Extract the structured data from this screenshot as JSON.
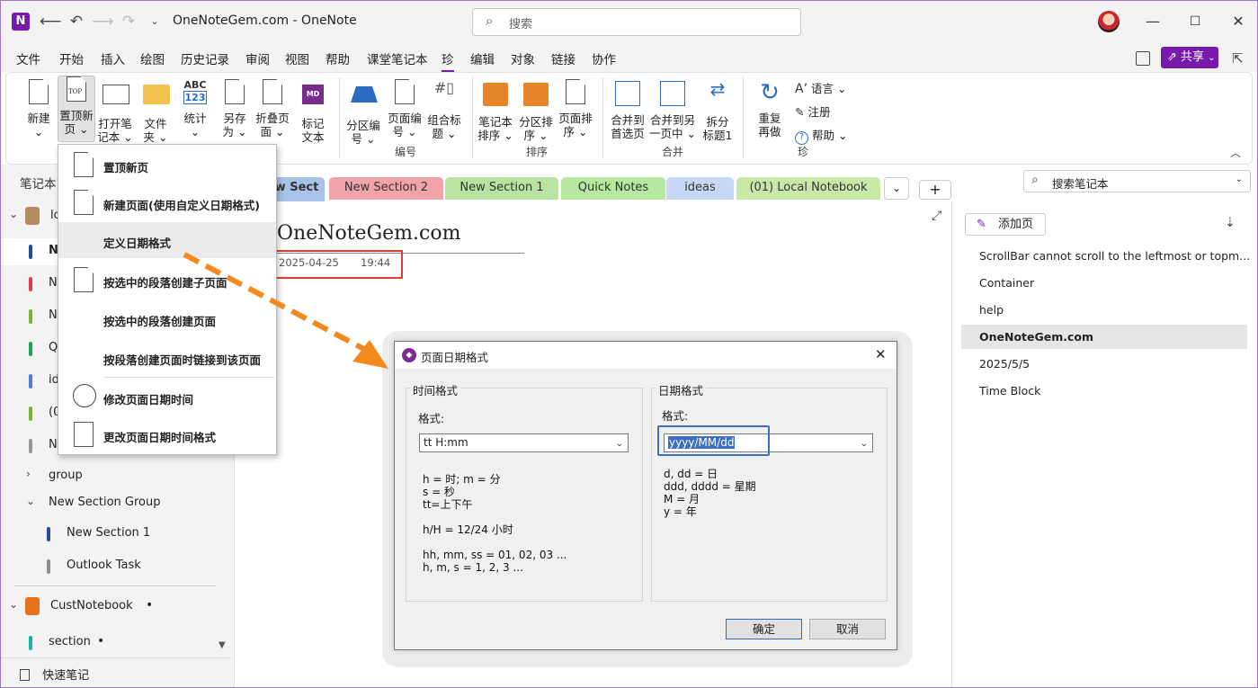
{
  "window": {
    "title": "OneNoteGem.com  -  OneNote",
    "search_placeholder": "搜索",
    "logo_letter": "N"
  },
  "menu": [
    "文件",
    "开始",
    "插入",
    "绘图",
    "历史记录",
    "审阅",
    "视图",
    "帮助",
    "课堂笔记本",
    "珍",
    "编辑",
    "对象",
    "链接",
    "协作"
  ],
  "menu_active_index": 9,
  "share_label": "共享",
  "ribbon": {
    "buttons": [
      {
        "id": "new",
        "l1": "新建",
        "l2": "⌄"
      },
      {
        "id": "top_new_page",
        "l1": "置顶新",
        "l2": "页 ⌄"
      },
      {
        "id": "open_notebook",
        "l1": "打开笔",
        "l2": "记本 ⌄"
      },
      {
        "id": "folder",
        "l1": "文件",
        "l2": "夹 ⌄"
      },
      {
        "id": "stats",
        "l1": "统计",
        "l2": "⌄"
      },
      {
        "id": "save_as",
        "l1": "另存",
        "l2": "为 ⌄"
      },
      {
        "id": "fold_page",
        "l1": "折叠页",
        "l2": "面 ⌄"
      },
      {
        "id": "markdown",
        "l1": "标记",
        "l2": "文本"
      },
      {
        "id": "section_no",
        "l1": "分区编",
        "l2": "号 ⌄"
      },
      {
        "id": "page_no",
        "l1": "页面编",
        "l2": "号 ⌄"
      },
      {
        "id": "heading_no",
        "l1": "组合标",
        "l2": "题 ⌄"
      },
      {
        "id": "nb_sort",
        "l1": "笔记本",
        "l2": "排序 ⌄"
      },
      {
        "id": "sec_sort",
        "l1": "分区排",
        "l2": "序 ⌄"
      },
      {
        "id": "page_sort",
        "l1": "页面排",
        "l2": "序 ⌄"
      },
      {
        "id": "merge_first",
        "l1": "合并到",
        "l2": "首选页"
      },
      {
        "id": "merge_other",
        "l1": "合并到另",
        "l2": "一页中 ⌄"
      },
      {
        "id": "split",
        "l1": "拆分",
        "l2": "标题1"
      },
      {
        "id": "redo",
        "l1": "重复",
        "l2": "再做"
      }
    ],
    "small_buttons": [
      {
        "label": "语言 ⌄"
      },
      {
        "label": "注册"
      },
      {
        "label": "帮助  ⌄"
      }
    ],
    "icon_texts": {
      "top": "TOP",
      "abc": "ABC",
      "num": "123",
      "md": "MD",
      "hash": "#"
    },
    "groups": [
      {
        "label": "编号"
      },
      {
        "label": "排序"
      },
      {
        "label": "合并"
      },
      {
        "label": "珍"
      }
    ]
  },
  "dropdown": [
    {
      "label": "置顶新页"
    },
    {
      "label": "新建页面(使用自定义日期格式)"
    },
    {
      "label": "定义日期格式"
    },
    {
      "label": "按选中的段落创建子页面"
    },
    {
      "label": "按选中的段落创建页面"
    },
    {
      "label": "按段落创建页面时链接到该页面"
    },
    {
      "label": "修改页面日期时间"
    },
    {
      "label": "更改页面日期时间格式"
    }
  ],
  "nav": {
    "header": "笔记本",
    "items": [
      {
        "label": "lo",
        "color": "#b58d5e"
      },
      {
        "label": "N",
        "color": "#1f4e9c"
      },
      {
        "label": "N",
        "color": "#e03c4f"
      },
      {
        "label": "N",
        "color": "#76b82a"
      },
      {
        "label": "Q",
        "color": "#1aa55c"
      },
      {
        "label": "id",
        "color": "#4f7fd8"
      },
      {
        "label": "(0",
        "color": "#76b82a"
      },
      {
        "label": "N",
        "color": "#9a9a9a"
      },
      {
        "label": "group"
      },
      {
        "label": "New Section Group"
      },
      {
        "label": "New Section 1",
        "color": "#1f4e9c"
      },
      {
        "label": "Outlook Task",
        "color": "#8c8c8c"
      },
      {
        "label": "CustNotebook",
        "color": "#e8721c"
      },
      {
        "label": "section",
        "color": "#1ab3a6"
      }
    ],
    "quick_notes": "快速笔记"
  },
  "tabs": [
    {
      "label": "w Sect",
      "color": "#a8c2e8"
    },
    {
      "label": "New Section 2",
      "color": "#f0a3a8"
    },
    {
      "label": "New Section 1",
      "color": "#b8e3a0"
    },
    {
      "label": "Quick Notes",
      "color": "#b6e8a0"
    },
    {
      "label": "ideas",
      "color": "#c6d8f4"
    },
    {
      "label": "(01) Local Notebook",
      "color": "#c8e8a8"
    }
  ],
  "tab_more": "⌄",
  "tab_add": "+",
  "search_notebook": "搜索笔记本",
  "page": {
    "title": "OneNoteGem.com",
    "date": "2025-04-25",
    "time": "19:44"
  },
  "right": {
    "add_page": "添加页",
    "pages": [
      {
        "label": "ScrollBar cannot scroll to the leftmost or topm..."
      },
      {
        "label": "Container"
      },
      {
        "label": "help"
      },
      {
        "label": "OneNoteGem.com"
      },
      {
        "label": "2025/5/5"
      },
      {
        "label": "Time Block"
      }
    ],
    "selected_index": 3
  },
  "dialog": {
    "title": "页面日期格式",
    "time_group": "时间格式",
    "time_label": "格式:",
    "time_value": "tt H:mm",
    "time_help": "h = 时; m = 分\ns = 秒\ntt=上下午\n\nh/H = 12/24 小时\n\nhh, mm, ss = 01, 02, 03 ...\nh, m, s = 1, 2, 3 ...",
    "date_group": "日期格式",
    "date_label": "格式:",
    "date_value": "yyyy/MM/dd",
    "date_help": "d, dd = 日\nddd, dddd = 星期\nM = 月\ny = 年",
    "ok": "确定",
    "cancel": "取消"
  },
  "colors": {
    "accent": "#7719aa",
    "arrow": "#f28a1e",
    "highlight": "#e03c31",
    "focus": "#3b6fc4"
  }
}
